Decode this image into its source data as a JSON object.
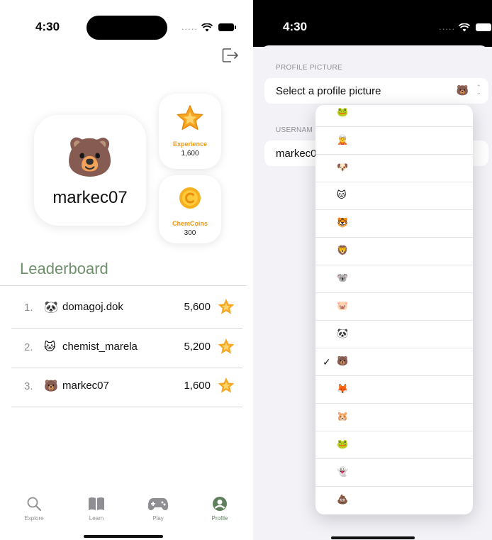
{
  "left": {
    "status": {
      "time": "4:30",
      "signal": "....."
    },
    "profile": {
      "avatar_emoji": "🐻",
      "username": "markec07"
    },
    "stats": {
      "experience": {
        "label": "Experience",
        "value": "1,600"
      },
      "chemcoins": {
        "label": "ChemCoins",
        "value": "300"
      }
    },
    "leaderboard": {
      "title": "Leaderboard",
      "rows": [
        {
          "rank": "1.",
          "emoji": "🐼",
          "name": "domagoj.dok",
          "score": "5,600"
        },
        {
          "rank": "2.",
          "emoji": "🐱",
          "name": "chemist_marela",
          "score": "5,200"
        },
        {
          "rank": "3.",
          "emoji": "🐻",
          "name": "markec07",
          "score": "1,600"
        }
      ]
    },
    "tabs": [
      {
        "label": "Explore",
        "icon": "magnifying-glass-icon"
      },
      {
        "label": "Learn",
        "icon": "book-icon"
      },
      {
        "label": "Play",
        "icon": "gamecontroller-icon"
      },
      {
        "label": "Profile",
        "icon": "person-circle-icon",
        "active": true
      }
    ],
    "colors": {
      "accent_green": "#6f8f6d",
      "orange": "#ef9a14"
    }
  },
  "right": {
    "status": {
      "time": "4:30",
      "signal": "....."
    },
    "profile_picture": {
      "section_label": "PROFILE PICTURE",
      "cell_label": "Select a profile picture",
      "selected_emoji": "🐻"
    },
    "username": {
      "section_label": "USERNAM",
      "value": "markec0"
    },
    "picker_options": [
      {
        "emoji": "🐸",
        "checked": ""
      },
      {
        "emoji": "🧝",
        "checked": ""
      },
      {
        "emoji": "🐶",
        "checked": ""
      },
      {
        "emoji": "🐱",
        "checked": ""
      },
      {
        "emoji": "🐯",
        "checked": ""
      },
      {
        "emoji": "🦁",
        "checked": ""
      },
      {
        "emoji": "🐨",
        "checked": ""
      },
      {
        "emoji": "🐷",
        "checked": ""
      },
      {
        "emoji": "🐼",
        "checked": ""
      },
      {
        "emoji": "🐻",
        "checked": "✓"
      },
      {
        "emoji": "🦊",
        "checked": ""
      },
      {
        "emoji": "🐹",
        "checked": ""
      },
      {
        "emoji": "🐸",
        "checked": ""
      },
      {
        "emoji": "👻",
        "checked": ""
      },
      {
        "emoji": "💩",
        "checked": ""
      }
    ]
  }
}
